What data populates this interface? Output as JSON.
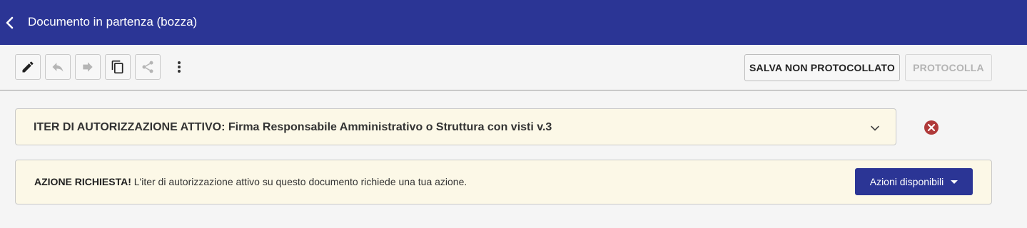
{
  "header": {
    "title": "Documento in partenza (bozza)"
  },
  "toolbar": {
    "buttons": [
      {
        "icon": "pencil-icon",
        "enabled": true
      },
      {
        "icon": "reply-icon",
        "enabled": false
      },
      {
        "icon": "forward-icon",
        "enabled": false
      },
      {
        "icon": "copy-icon",
        "enabled": true
      },
      {
        "icon": "share-icon",
        "enabled": false
      },
      {
        "icon": "more-vertical-icon",
        "enabled": true
      }
    ],
    "save_label": "SALVA NON PROTOCOLLATO",
    "protocol_label": "PROTOCOLLA"
  },
  "iter": {
    "text": "ITER DI AUTORIZZAZIONE ATTIVO: Firma Responsabile Amministrativo o Struttura con visti v.3"
  },
  "action": {
    "bold": "AZIONE RICHIESTA!",
    "text": " L'iter di autorizzazione attivo su questo documento richiede una tua azione.",
    "button_label": "Azioni disponibili"
  },
  "colors": {
    "primary": "#2b3595",
    "panel_bg": "#fcf8e7",
    "close_red": "#b03a3a"
  }
}
